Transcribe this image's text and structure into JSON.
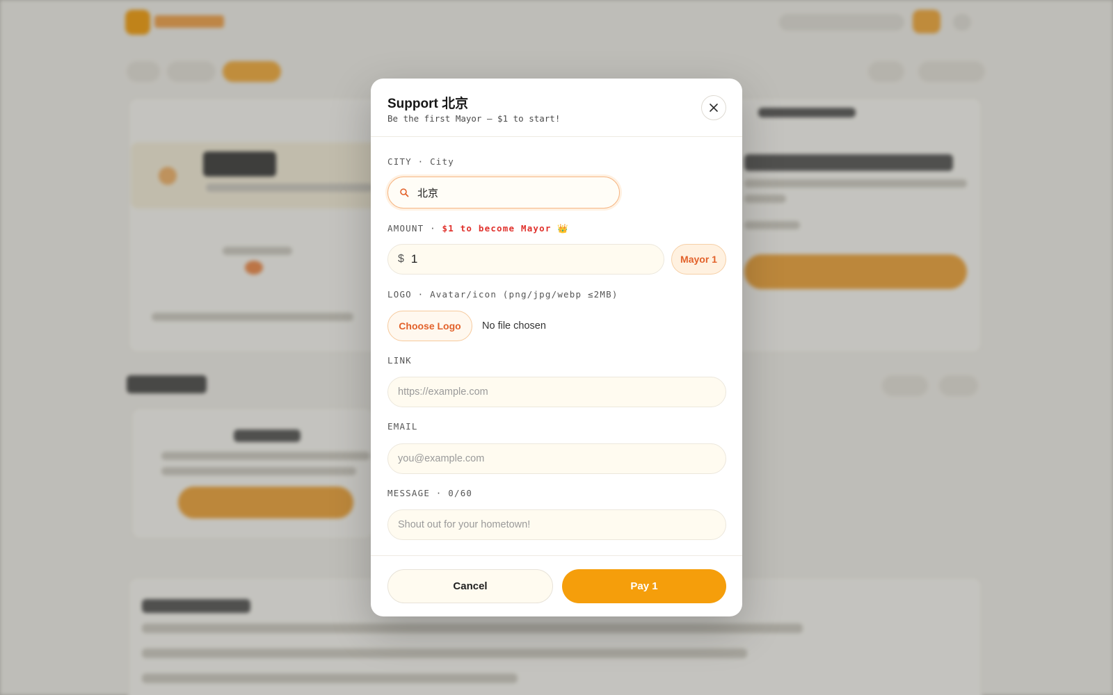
{
  "modal": {
    "title": "Support 北京",
    "subtitle": "Be the first Mayor — $1 to start!"
  },
  "city": {
    "label": "CITY · City",
    "value": "北京"
  },
  "amount": {
    "label_prefix": "AMOUNT · ",
    "label_accent": "$1 to become Mayor 👑",
    "currency": "$",
    "value": "1",
    "chip_label": "Mayor 1"
  },
  "logo": {
    "label": "LOGO · Avatar/icon (png/jpg/webp ≤2MB)",
    "button_label": "Choose Logo",
    "file_status": "No file chosen"
  },
  "link": {
    "label": "LINK",
    "placeholder": "https://example.com"
  },
  "email": {
    "label": "EMAIL",
    "placeholder": "you@example.com"
  },
  "message": {
    "label": "MESSAGE · 0/60",
    "placeholder": "Shout out for your hometown!"
  },
  "footer": {
    "cancel_label": "Cancel",
    "pay_label": "Pay 1"
  },
  "colors": {
    "accent": "#f59e0b",
    "accent_text": "#e2612a",
    "label_highlight": "#e0312c",
    "overlay": "#bcbbb6"
  }
}
